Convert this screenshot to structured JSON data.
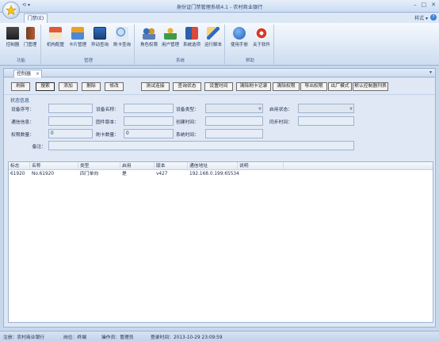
{
  "window": {
    "title": "身份证门禁管理系统4.1 - 农村商业银行"
  },
  "qat": {
    "save_glyph": "⟲",
    "dropdown_glyph": "▾"
  },
  "win_buttons": {
    "minimize": "–",
    "restore": "□",
    "close": "✕"
  },
  "ribbon_tab": {
    "label": "门禁(E)"
  },
  "style_menu": {
    "label": "样式 ▾",
    "help": "?"
  },
  "ribbon": {
    "groups": [
      {
        "label": "功能",
        "buttons": [
          "控制器",
          "门管理"
        ]
      },
      {
        "label": "管理",
        "buttons": [
          "机构配置",
          "卡片管理",
          "异动查询",
          "刷卡查询"
        ]
      },
      {
        "label": "系统",
        "buttons": [
          "角色权限",
          "用户管理",
          "系统选项",
          "运行脚本"
        ]
      },
      {
        "label": "帮助",
        "buttons": [
          "使用手册",
          "关于软件"
        ]
      }
    ]
  },
  "doc_tab": {
    "label": "控制器",
    "close": "×",
    "dropdown": "▾"
  },
  "toolbar": {
    "refresh": "刷新",
    "search": "搜索",
    "add": "添加",
    "delete": "删除",
    "modify": "修改",
    "test_connection": "测试连接",
    "query_status": "查询状态",
    "set_time": "设置时间",
    "clear_card_records": "清除刷卡记录",
    "clear_permissions": "清除权限",
    "export_permissions": "导出权限",
    "factory_mode": "出厂模式",
    "default_controller_list": "默认控制器列表"
  },
  "status_panel": {
    "title": "状态信息",
    "device_serial_label": "设备序号：",
    "device_name_label": "设备名称：",
    "device_type_label": "设备类型：",
    "enabled_status_label": "启用状态：",
    "comm_info_label": "通信信息：",
    "firmware_label": "固件版本：",
    "create_time_label": "创建时间：",
    "sync_time_label": "同步时间：",
    "perm_count_label": "权限数量：",
    "perm_count_value": "0",
    "card_count_label": "刷卡数量：",
    "card_count_value": "0",
    "system_time_label": "系统时间：",
    "remark_label": "备注："
  },
  "table": {
    "columns": [
      "标志",
      "名称",
      "类型",
      "启用",
      "版本",
      "通信地址",
      "说明"
    ],
    "rows": [
      [
        "61920",
        "No.61920",
        "四门单向",
        "是",
        "v427",
        "192.168.0.199:65534",
        ""
      ]
    ]
  },
  "statusbar": {
    "unit": "注册：农村商业银行",
    "position": "岗位：终端",
    "operator": "操作员：管理员",
    "login_time": "登录时间：2013-10-29 23:09:59"
  },
  "colors": {
    "ribbon_bg": "#dde8f6",
    "accent": "#3f7fd0"
  }
}
